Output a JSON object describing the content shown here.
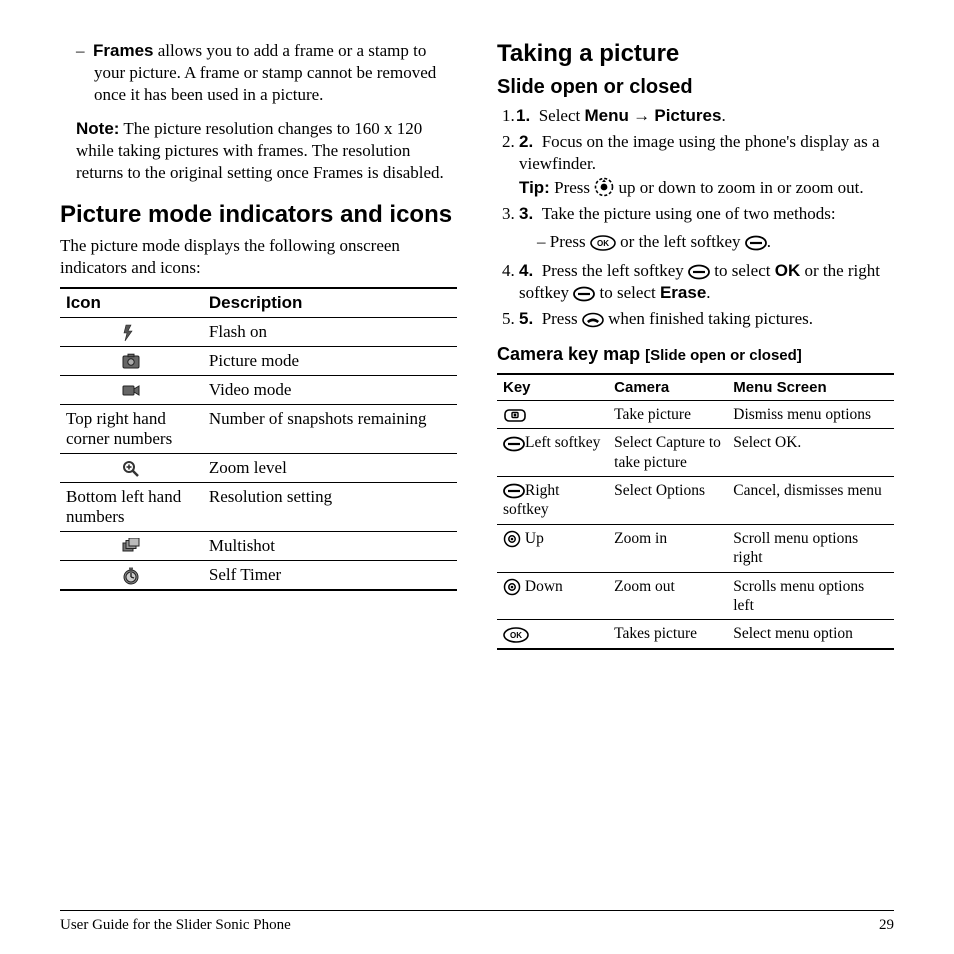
{
  "col1": {
    "frames": {
      "label": "Frames",
      "text": " allows you to add a frame or a stamp to your picture. A frame or stamp cannot be removed once it has been used in a picture."
    },
    "note": {
      "label": "Note:",
      "text": "  The picture resolution changes to 160 x 120 while taking pictures with frames. The resolution returns to the original setting once Frames is disabled."
    },
    "h2": "Picture mode indicators and icons",
    "intro": "The picture mode displays the following onscreen indicators and icons:",
    "th": {
      "icon": "Icon",
      "desc": "Description"
    },
    "rows": [
      {
        "icon": "flash",
        "desc": "Flash on"
      },
      {
        "icon": "picture",
        "desc": "Picture mode"
      },
      {
        "icon": "video",
        "desc": "Video mode"
      },
      {
        "icon_text": "Top right hand corner numbers",
        "desc": "Number of snapshots remaining"
      },
      {
        "icon": "zoom",
        "desc": "Zoom level"
      },
      {
        "icon_text": "Bottom left hand numbers",
        "desc": "Resolution setting"
      },
      {
        "icon": "multishot",
        "desc": "Multishot"
      },
      {
        "icon": "selftimer",
        "desc": "Self Timer"
      }
    ]
  },
  "col2": {
    "h2": "Taking a picture",
    "h3": "Slide open or closed",
    "s1": {
      "pre": "Select ",
      "menu": "Menu",
      "arrow": " → ",
      "pics": "Pictures",
      "suf": "."
    },
    "s2": "Focus on the image using the phone's display as a viewfinder.",
    "tip": {
      "label": "Tip:",
      "pre": "  Press  ",
      "suf": "  up or down to zoom in or zoom out."
    },
    "s3": "Take the picture using one of two methods:",
    "s3a": {
      "dash": "–   ",
      "pre": "Press  ",
      "mid": "  or the left softkey  ",
      "suf": "."
    },
    "s4": {
      "pre": "Press the left softkey  ",
      "mid1": "  to select ",
      "ok": "OK",
      "mid2": " or the right softkey  ",
      "mid3": "  to select ",
      "erase": "Erase",
      "suf": "."
    },
    "s5": {
      "pre": "Press  ",
      "suf": " when finished taking pictures."
    },
    "h4": "Camera key map",
    "h4sub": "[Slide open or closed]",
    "kth": {
      "key": "Key",
      "cam": "Camera",
      "ms": "Menu Screen"
    },
    "krows": [
      {
        "icon": "camera-key",
        "label": "",
        "cam": "Take picture",
        "ms": "Dismiss menu options"
      },
      {
        "icon": "softkey",
        "label": "Left softkey",
        "cam": "Select Capture to take picture",
        "ms": "Select OK."
      },
      {
        "icon": "softkey",
        "label": "Right softkey",
        "cam": "Select Options",
        "ms": "Cancel, dismisses menu"
      },
      {
        "icon": "nav",
        "label": " Up",
        "cam": "Zoom in",
        "ms": "Scroll menu options right"
      },
      {
        "icon": "nav",
        "label": " Down",
        "cam": "Zoom out",
        "ms": "Scrolls menu options left"
      },
      {
        "icon": "ok",
        "label": "",
        "cam": "Takes picture",
        "ms": "Select menu option"
      }
    ]
  },
  "footer": {
    "title": "User Guide for the Slider Sonic Phone",
    "page": "29"
  }
}
